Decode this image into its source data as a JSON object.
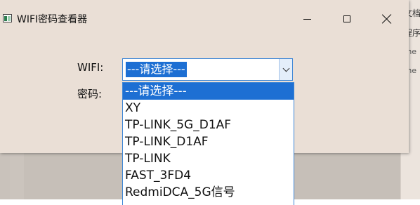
{
  "window": {
    "title": "WIFI密码查看器"
  },
  "background": {
    "right_panel_lines": [
      "文档",
      "程序",
      "rne",
      "rne"
    ]
  },
  "form": {
    "wifi_label": "WIFI:",
    "password_label": "密码:",
    "wifi_combo": {
      "selected": "---请选择---",
      "options": [
        "---请选择---",
        "XY",
        "TP-LINK_5G_D1AF",
        "TP-LINK_D1AF",
        "TP-LINK",
        "FAST_3FD4",
        "RedmiDCA_5G信号"
      ],
      "highlighted_index": 0
    }
  }
}
